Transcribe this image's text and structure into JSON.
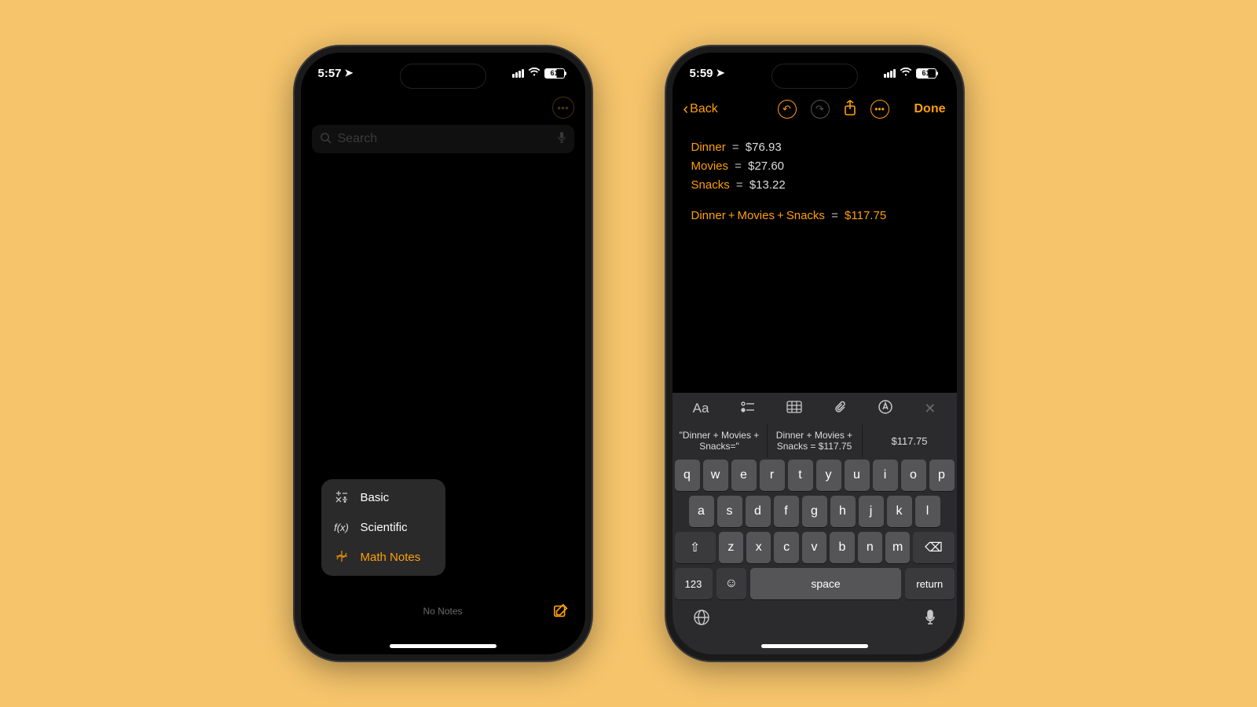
{
  "phone1": {
    "status": {
      "time": "5:57",
      "battery": "61"
    },
    "search": {
      "placeholder": "Search"
    },
    "menu": {
      "basic": "Basic",
      "scientific": "Scientific",
      "math_notes": "Math Notes"
    },
    "footer": {
      "no_notes": "No Notes"
    }
  },
  "phone2": {
    "status": {
      "time": "5:59",
      "battery": "61"
    },
    "nav": {
      "back": "Back",
      "done": "Done"
    },
    "note": {
      "lines": [
        {
          "var": "Dinner",
          "val": "$76.93"
        },
        {
          "var": "Movies",
          "val": "$27.60"
        },
        {
          "var": "Snacks",
          "val": "$13.22"
        }
      ],
      "sum": {
        "a": "Dinner",
        "b": "Movies",
        "c": "Snacks",
        "result": "$117.75"
      }
    },
    "suggestions": {
      "s1": "\"Dinner + Movies + Snacks=\"",
      "s2": "Dinner + Movies + Snacks = $117.75",
      "s3": "$117.75"
    },
    "keys": {
      "row1": [
        "q",
        "w",
        "e",
        "r",
        "t",
        "y",
        "u",
        "i",
        "o",
        "p"
      ],
      "row2": [
        "a",
        "s",
        "d",
        "f",
        "g",
        "h",
        "j",
        "k",
        "l"
      ],
      "row3": [
        "z",
        "x",
        "c",
        "v",
        "b",
        "n",
        "m"
      ],
      "num": "123",
      "space": "space",
      "return": "return"
    }
  }
}
